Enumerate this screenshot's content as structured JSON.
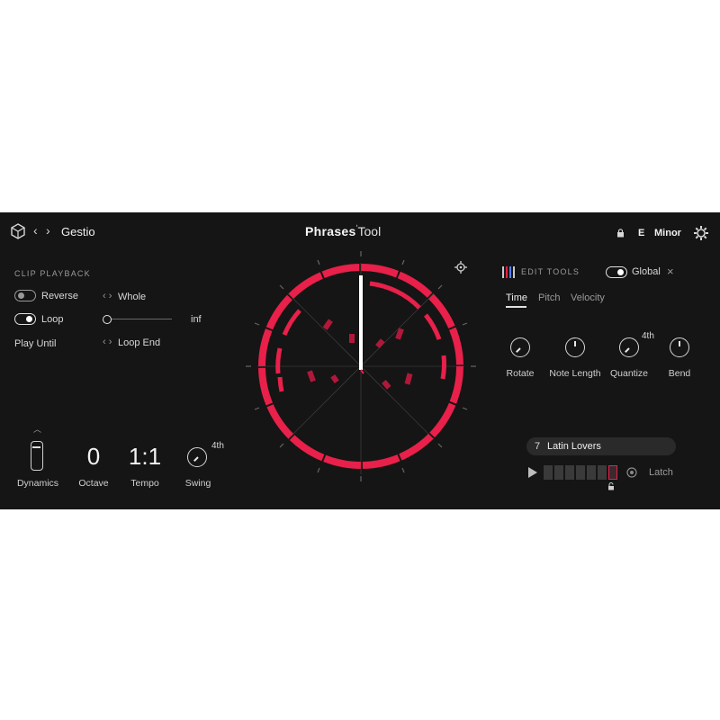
{
  "header": {
    "preset_name": "Gestio",
    "logo_bold": "Phrases",
    "logo_light": "Tool",
    "key_root": "E",
    "key_scale": "Minor"
  },
  "clip_playback": {
    "title": "CLIP PLAYBACK",
    "reverse_label": "Reverse",
    "loop_label": "Loop",
    "play_until_label": "Play Until",
    "whole_label": "Whole",
    "loop_end_label": "Loop End",
    "slider_end": "inf"
  },
  "bottom_left": {
    "dynamics_label": "Dynamics",
    "octave_value": "0",
    "octave_label": "Octave",
    "tempo_value": "1:1",
    "tempo_label": "Tempo",
    "swing_value": "4th",
    "swing_label": "Swing"
  },
  "edit_tools": {
    "title": "EDIT TOOLS",
    "global_label": "Global",
    "tabs": [
      "Time",
      "Pitch",
      "Velocity"
    ],
    "active_tab": "Time",
    "knobs": [
      {
        "label": "Rotate",
        "value": ""
      },
      {
        "label": "Note Length",
        "value": ""
      },
      {
        "label": "Quantize",
        "value": "4th"
      },
      {
        "label": "Bend",
        "value": ""
      }
    ]
  },
  "pattern": {
    "number": "7",
    "name": "Latin Lovers",
    "latch_label": "Latch"
  },
  "colors": {
    "accent": "#e8204a",
    "background": "#151515",
    "text": "#e8e8e8"
  }
}
